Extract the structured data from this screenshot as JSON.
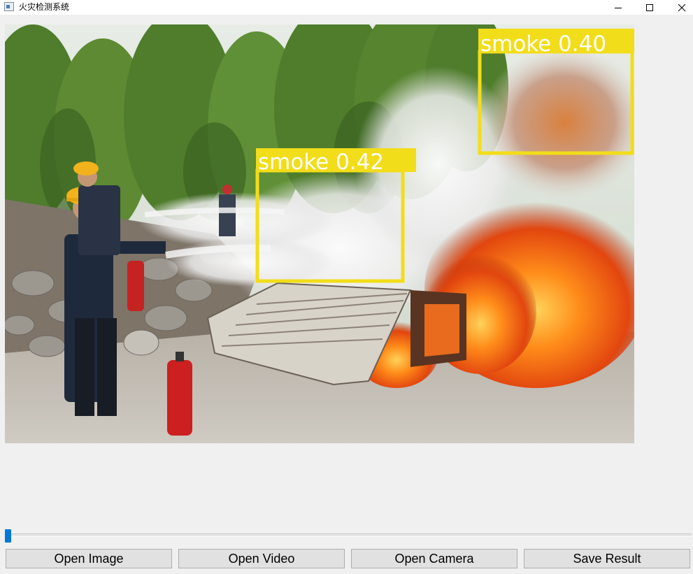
{
  "window": {
    "title": "火灾检测系统",
    "minimize_icon": "minimize-icon",
    "maximize_icon": "maximize-icon",
    "close_icon": "close-icon"
  },
  "detections": [
    {
      "label": "smoke 0.42",
      "color": "#f2dd1a"
    },
    {
      "label": "smoke 0.40",
      "color": "#f2dd1a"
    }
  ],
  "progress": {
    "value": 0.0,
    "accent": "#0078d7"
  },
  "buttons": {
    "open_image": "Open Image",
    "open_video": "Open Video",
    "open_camera": "Open Camera",
    "save_result": "Save Result"
  }
}
